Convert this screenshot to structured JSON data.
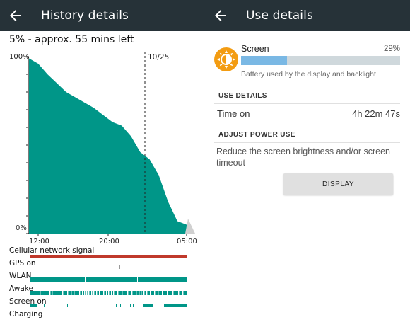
{
  "left": {
    "title": "History details",
    "subtitle": "5% - approx. 55 mins left",
    "chart": {
      "y_top_label": "100%",
      "y_bottom_label": "0%",
      "date_marker": "10/25",
      "x_ticks": [
        "12:00",
        "20:00",
        "05:00"
      ]
    },
    "tracks": [
      "Cellular network signal",
      "GPS on",
      "WLAN",
      "Awake",
      "Screen on",
      "Charging"
    ]
  },
  "right": {
    "title": "Use details",
    "item": {
      "name": "Screen",
      "percent": "29%",
      "usage_fraction": 0.29,
      "description": "Battery used by the display and backlight"
    },
    "use_details_header": "USE DETAILS",
    "time_on_label": "Time on",
    "time_on_value": "4h 22m 47s",
    "adjust_header": "ADJUST POWER USE",
    "hint": "Reduce the screen brightness and/or screen timeout",
    "display_button": "DISPLAY"
  },
  "colors": {
    "appbar": "#263238",
    "battery_fill": "#009688",
    "cellular": "#c0392b",
    "track": "#009688",
    "usage_bar": "#7ab8e4",
    "icon": "#f39c12"
  },
  "chart_data": {
    "type": "area",
    "x": [
      "10:00",
      "10:15",
      "10:30",
      "11:00",
      "12:00",
      "14:00",
      "16:00",
      "18:00",
      "20:00",
      "22:00",
      "24:00",
      "00:30",
      "01:00",
      "02:00",
      "03:00",
      "04:00",
      "04:30",
      "05:00"
    ],
    "values": [
      99,
      96,
      90,
      85,
      80,
      77,
      74,
      71,
      67,
      63,
      61,
      55,
      46,
      42,
      33,
      18,
      7,
      5
    ],
    "ylim": [
      0,
      100
    ]
  }
}
